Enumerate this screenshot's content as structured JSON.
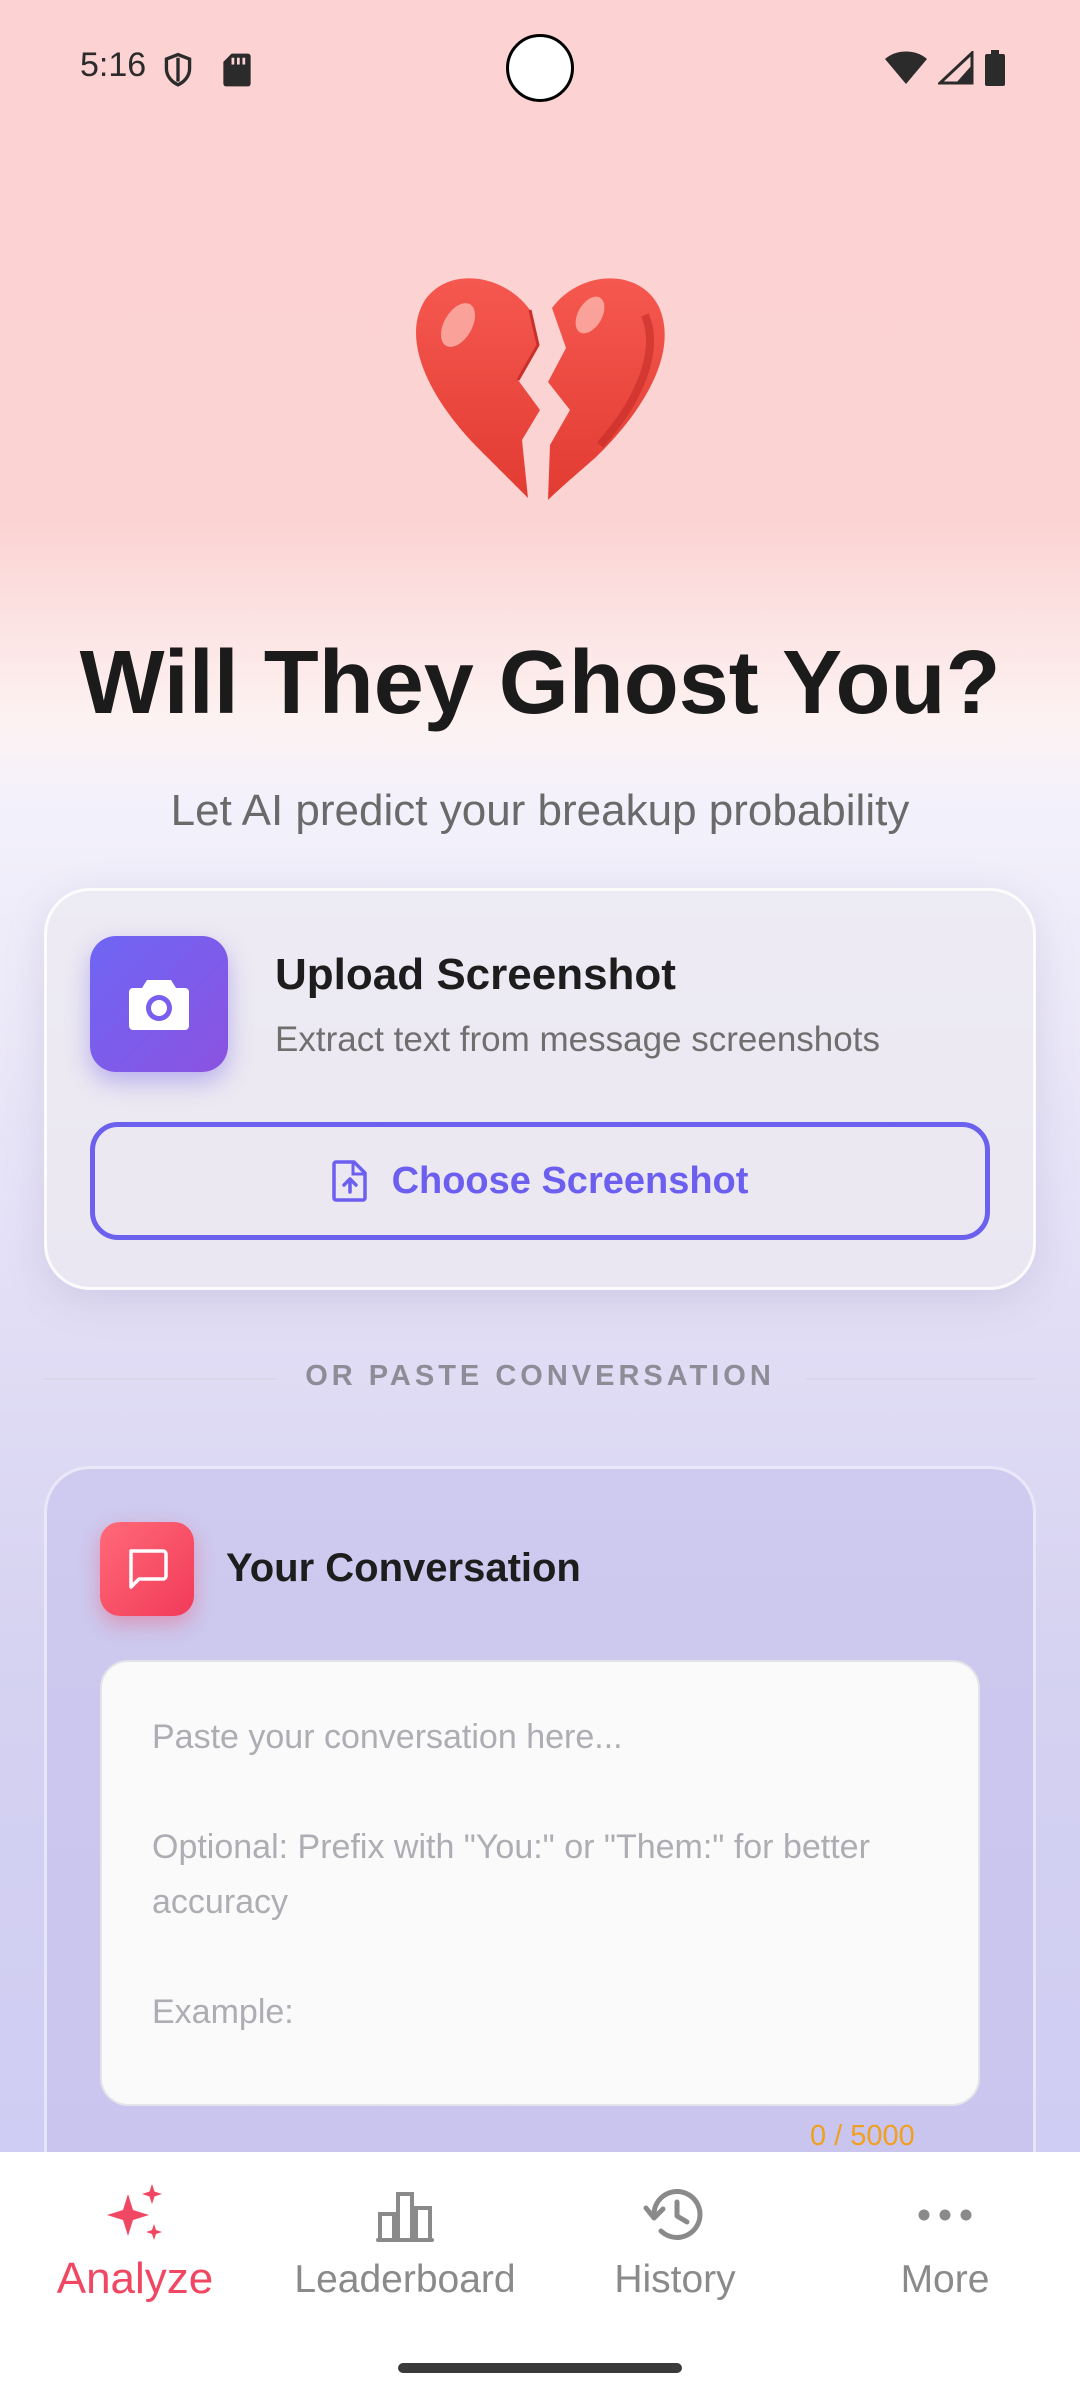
{
  "status_bar": {
    "time": "5:16",
    "icons": [
      "shield-icon",
      "sd-card-icon",
      "wifi-icon",
      "signal-icon",
      "battery-icon"
    ]
  },
  "header": {
    "emoji_icon": "broken-heart-icon",
    "title": "Will They Ghost You?",
    "subtitle": "Let AI predict your breakup probability"
  },
  "upload": {
    "icon": "camera-icon",
    "title": "Upload Screenshot",
    "subtitle": "Extract text from message screenshots",
    "button_icon": "file-upload-icon",
    "button_label": "Choose Screenshot"
  },
  "divider": {
    "label": "OR PASTE CONVERSATION"
  },
  "conversation": {
    "icon": "chat-icon",
    "title": "Your Conversation",
    "value": "",
    "placeholder": "Paste your conversation here...\n\nOptional: Prefix with \"You:\" or \"Them:\" for better accuracy\n\nExample:",
    "char_count": "0 / 5000"
  },
  "bottom_nav": {
    "items": [
      {
        "label": "Analyze",
        "icon": "sparkles-icon",
        "active": true
      },
      {
        "label": "Leaderboard",
        "icon": "bar-chart-icon",
        "active": false
      },
      {
        "label": "History",
        "icon": "history-icon",
        "active": false
      },
      {
        "label": "More",
        "icon": "more-dots-icon",
        "active": false
      }
    ]
  },
  "colors": {
    "accent_primary": "#6c5ff0",
    "accent_nav_active": "#f04862",
    "char_count": "#f0a020"
  }
}
